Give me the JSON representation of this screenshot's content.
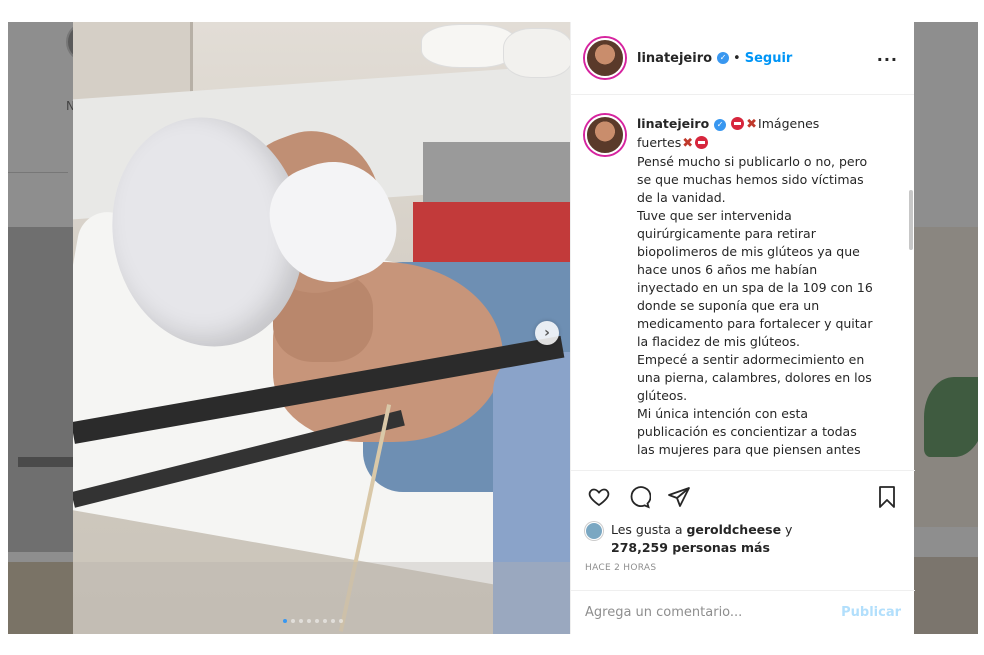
{
  "background": {
    "letter": "N"
  },
  "post": {
    "username": "linatejeiro",
    "separator": "•",
    "follow_label": "Seguir",
    "more_label": "...",
    "caption_username": "linatejeiro",
    "caption_lines": [
      "Imágenes",
      "fuertes",
      "Pensé mucho si publicarlo o no, pero",
      "se que muchas hemos sido víctimas",
      "de la vanidad.",
      "Tuve que ser intervenida",
      "quirúrgicamente para retirar",
      "biopolimeros de mis glúteos ya que",
      "hace unos 6 años me habían",
      "inyectado en un spa de la 109 con 16",
      "donde se suponía que era un",
      "medicamento para fortalecer y quitar",
      "la flacidez de mis glúteos.",
      "Empecé a sentir adormecimiento en",
      "una pierna, calambres, dolores en los",
      "glúteos.",
      "Mi única intención con esta",
      "publicación es concientizar a todas",
      "las mujeres para que piensen antes"
    ],
    "likes_prefix": "Les gusta a",
    "likes_user": "geroldcheese",
    "likes_and": "y",
    "likes_count": "278,259 personas más",
    "time": "HACE 2 HORAS",
    "comment_placeholder": "Agrega un comentario...",
    "publish_label": "Publicar",
    "carousel": {
      "total": 8,
      "active": 0
    }
  },
  "colors": {
    "accent": "#0095f6",
    "verified": "#3897f0",
    "text": "#262626",
    "muted": "#8e8e8e"
  }
}
